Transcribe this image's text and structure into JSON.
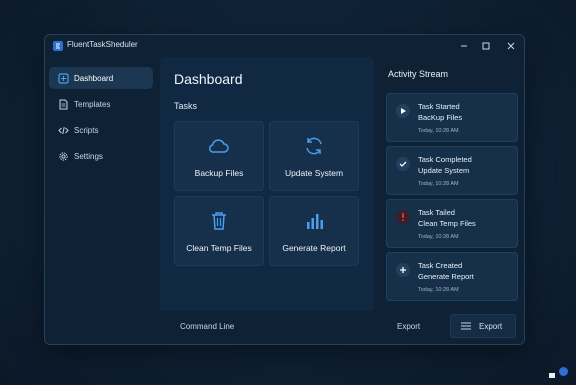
{
  "app": {
    "title": "FluentTaskSheduler"
  },
  "sidebar": {
    "items": [
      {
        "label": "Dashboard",
        "icon": "dashboard-icon",
        "active": true
      },
      {
        "label": "Templates",
        "icon": "document-icon",
        "active": false
      },
      {
        "label": "Scripts",
        "icon": "code-icon",
        "active": false
      },
      {
        "label": "Settings",
        "icon": "gear-icon",
        "active": false
      }
    ]
  },
  "main": {
    "title": "Dashboard",
    "tasks_heading": "Tasks",
    "tiles": [
      {
        "label": "Backup Files",
        "icon": "cloud-icon"
      },
      {
        "label": "Update System",
        "icon": "refresh-icon"
      },
      {
        "label": "Clean Temp Files",
        "icon": "trash-icon"
      },
      {
        "label": "Generate Report",
        "icon": "bar-chart-icon"
      }
    ]
  },
  "activity": {
    "title": "Activity Stream",
    "items": [
      {
        "status": "Task Started",
        "task": "BacKup Files",
        "time": "Today, 10:28 AM",
        "icon": "play-icon"
      },
      {
        "status": "Task Completed",
        "task": "Update System",
        "time": "Today, 10:28 AM",
        "icon": "check-icon"
      },
      {
        "status": "Task Tailed",
        "task": "Clean Temp Files",
        "time": "Today, 10:28 AM",
        "icon": "error-icon"
      },
      {
        "status": "Task Created",
        "task": "Generate Report",
        "time": "Today, 10:28 AM",
        "icon": "plus-icon"
      }
    ]
  },
  "bottom": {
    "command_label": "Command Line",
    "export_label": "Export",
    "export_button_label": "Export"
  },
  "colors": {
    "accent": "#2f6fd0",
    "icon_blue": "#4a9ef0",
    "error": "#e0443c"
  }
}
